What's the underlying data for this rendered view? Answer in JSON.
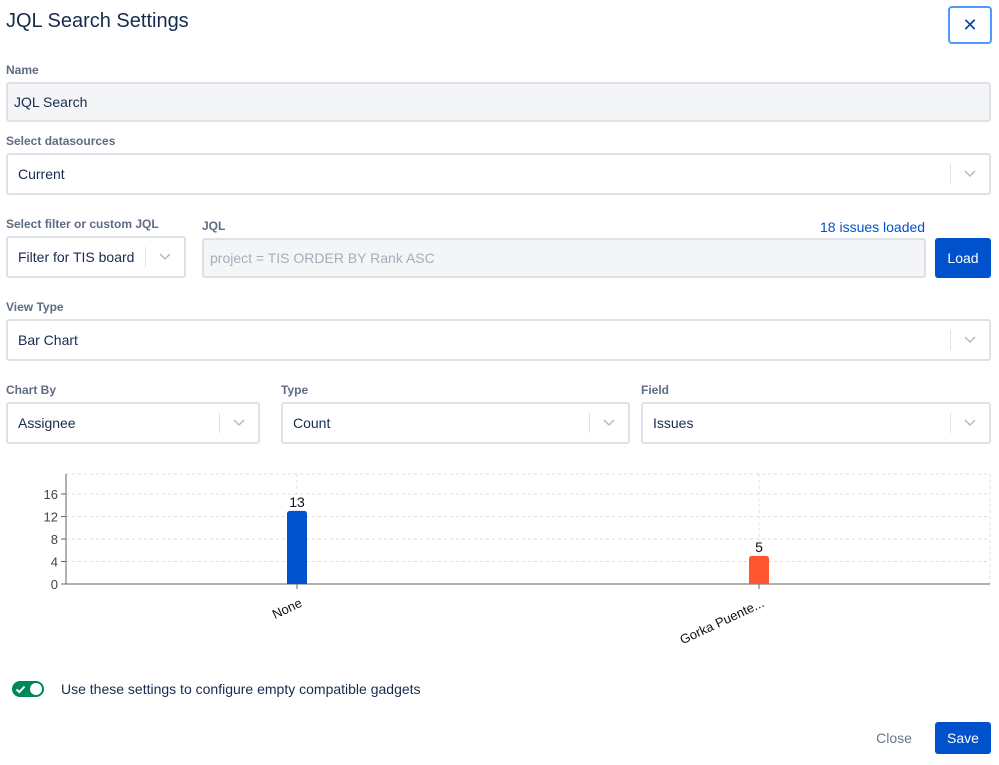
{
  "dialog": {
    "title": "JQL Search Settings",
    "close_icon": "close-icon"
  },
  "name_field": {
    "label": "Name",
    "value": "JQL Search"
  },
  "datasources": {
    "label": "Select datasources",
    "value": "Current"
  },
  "filter": {
    "label": "Select filter or custom JQL",
    "value": "Filter for TIS board"
  },
  "jql": {
    "label": "JQL",
    "placeholder": "project = TIS ORDER BY Rank ASC",
    "status": "18 issues loaded",
    "load_label": "Load"
  },
  "view_type": {
    "label": "View Type",
    "value": "Bar Chart"
  },
  "chart_by": {
    "label": "Chart By",
    "value": "Assignee"
  },
  "type": {
    "label": "Type",
    "value": "Count"
  },
  "field": {
    "label": "Field",
    "value": "Issues"
  },
  "chart_data": {
    "type": "bar",
    "categories": [
      "None",
      "Gorka Puente..."
    ],
    "values": [
      13,
      5
    ],
    "colors": [
      "#0052cc",
      "#ff5630"
    ],
    "ylim": [
      0,
      16
    ],
    "yticks": [
      0,
      4,
      8,
      12,
      16
    ],
    "grid": true,
    "title": "",
    "xlabel": "",
    "ylabel": ""
  },
  "toggle": {
    "on": true,
    "label": "Use these settings to configure empty compatible gadgets",
    "accent": "#00875a"
  },
  "footer": {
    "close_label": "Close",
    "save_label": "Save"
  },
  "colors": {
    "primary": "#0052cc",
    "text": "#172b4d",
    "muted": "#5e6c84"
  }
}
